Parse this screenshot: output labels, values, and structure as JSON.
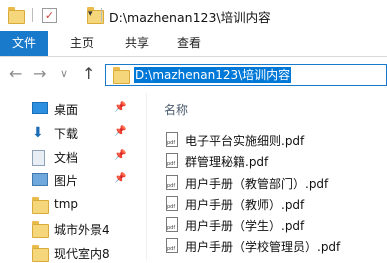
{
  "window": {
    "title": "D:\\mazhenan123\\培训内容"
  },
  "quick_access_toolbar": {
    "dropdown": "▾"
  },
  "ribbon": {
    "tabs": [
      "文件",
      "主页",
      "共享",
      "查看"
    ]
  },
  "address_bar": {
    "back": "←",
    "forward": "→",
    "recent": "∨",
    "up": "↑",
    "path": "D:\\mazhenan123\\培训内容"
  },
  "nav_pane": {
    "items": [
      {
        "label": "桌面",
        "icon": "desktop-icon",
        "pinned": true
      },
      {
        "label": "下载",
        "icon": "download-icon",
        "pinned": true
      },
      {
        "label": "文档",
        "icon": "documents-icon",
        "pinned": true
      },
      {
        "label": "图片",
        "icon": "pictures-icon",
        "pinned": true
      },
      {
        "label": "tmp",
        "icon": "folder-icon",
        "pinned": false
      },
      {
        "label": "城市外景4",
        "icon": "folder-icon",
        "pinned": false
      },
      {
        "label": "现代室内8",
        "icon": "folder-icon",
        "pinned": false
      }
    ],
    "pin_glyph": "📌"
  },
  "file_list": {
    "column_header": "名称",
    "files": [
      "电子平台实施细则.pdf",
      "群管理秘籍.pdf",
      "用户手册（教管部门）.pdf",
      "用户手册（教师）.pdf",
      "用户手册（学生）.pdf",
      "用户手册（学校管理员）.pdf"
    ]
  },
  "colors": {
    "accent": "#1979ca",
    "selection": "#0078d7",
    "folder": "#f6d67a"
  }
}
